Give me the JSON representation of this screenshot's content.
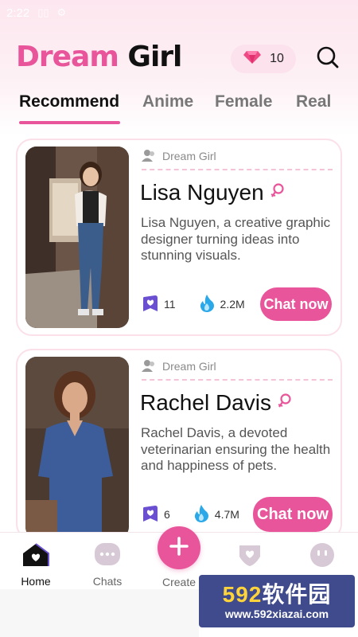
{
  "status_bar": {
    "time": "2:22"
  },
  "header": {
    "logo_word1": "Dream",
    "logo_word2": "Girl",
    "gems": "10"
  },
  "tabs": [
    {
      "label": "Recommend",
      "active": true
    },
    {
      "label": "Anime",
      "active": false
    },
    {
      "label": "Female",
      "active": false
    },
    {
      "label": "Real",
      "active": false
    }
  ],
  "cards": [
    {
      "creator": "Dream Girl",
      "name": "Lisa Nguyen",
      "description": "Lisa Nguyen, a creative graphic designer turning ideas into stunning visuals.",
      "bookmarks": "11",
      "popularity": "2.2M",
      "chat_label": "Chat now"
    },
    {
      "creator": "Dream Girl",
      "name": "Rachel Davis",
      "description": "Rachel Davis, a devoted veterinarian ensuring the health and happiness of pets.",
      "bookmarks": "6",
      "popularity": "4.7M",
      "chat_label": "Chat now"
    }
  ],
  "bottom_nav": {
    "home": "Home",
    "chats": "Chats",
    "create": "Create"
  },
  "watermark": {
    "title_num": "592",
    "title_text": "软件园",
    "url": "www.592xiazai.com"
  },
  "colors": {
    "accent": "#e8559a",
    "accent_light": "#fbe2ec"
  }
}
